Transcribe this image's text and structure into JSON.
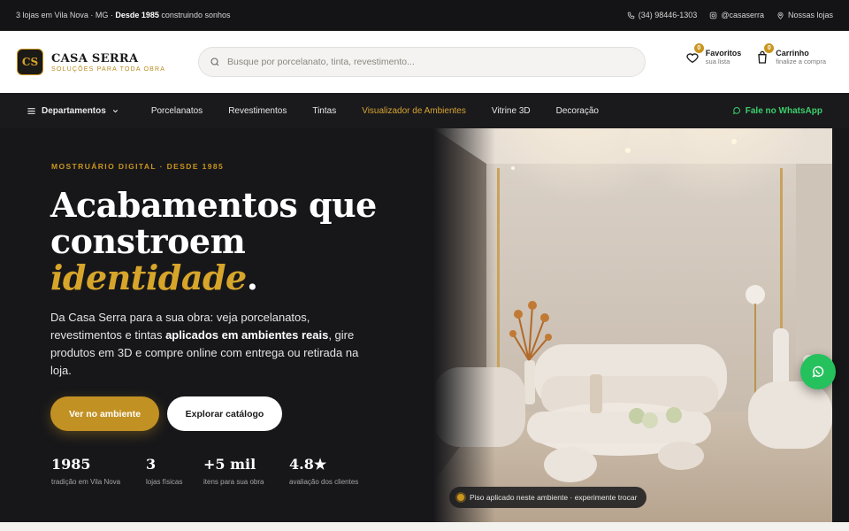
{
  "topbar": {
    "left_prefix": "3 lojas em Vila Nova · MG · ",
    "left_bold": "Desde 1985",
    "left_suffix": " construindo sonhos",
    "phone": "(34) 98446-1303",
    "instagram": "@casaserra",
    "stores": "Nossas lojas"
  },
  "header": {
    "logo_mark": "CS",
    "logo_name": "CASA SERRA",
    "logo_tagline": "SOLUÇÕES PARA TODA OBRA",
    "search_placeholder": "Busque por porcelanato, tinta, revestimento...",
    "favorites": {
      "title": "Favoritos",
      "subtitle": "sua lista",
      "count": "0"
    },
    "cart": {
      "title": "Carrinho",
      "subtitle": "finalize a compra",
      "count": "0"
    }
  },
  "nav": {
    "departments": "Departamentos",
    "links": [
      "Porcelanatos",
      "Revestimentos",
      "Tintas",
      "Visualizador de Ambientes",
      "Vitrine 3D",
      "Decoração"
    ],
    "active_index": 3,
    "whatsapp": "Fale no WhatsApp"
  },
  "hero": {
    "eyebrow": "MOSTRUÁRIO DIGITAL · DESDE 1985",
    "headline_line1": "Acabamentos que",
    "headline_line2": "constroem",
    "headline_accent": "identidade",
    "headline_end": ".",
    "lead_start": "Da Casa Serra para a sua obra: veja porcelanatos, revestimentos e tintas ",
    "lead_bold": "aplicados em ambientes reais",
    "lead_end": ", gire produtos em 3D e compre online com entrega ou retirada na loja.",
    "cta_primary": "Ver no ambiente",
    "cta_secondary": "Explorar catálogo",
    "stats": [
      {
        "value": "1985",
        "label": "tradição em Vila Nova"
      },
      {
        "value": "3",
        "label": "lojas físicas"
      },
      {
        "value": "+5 mil",
        "label": "itens para sua obra"
      },
      {
        "value": "4.8★",
        "label": "avaliação dos clientes"
      }
    ],
    "scene_caption": "Piso aplicado neste ambiente · experimente trocar"
  },
  "colors": {
    "accent": "#c9951e",
    "dark": "#17171a",
    "whatsapp": "#25c15d"
  },
  "icons": [
    "phone-icon",
    "instagram-icon",
    "location-pin-icon",
    "search-icon",
    "heart-icon",
    "bag-icon",
    "menu-icon",
    "chevron-down-icon",
    "whatsapp-icon"
  ]
}
